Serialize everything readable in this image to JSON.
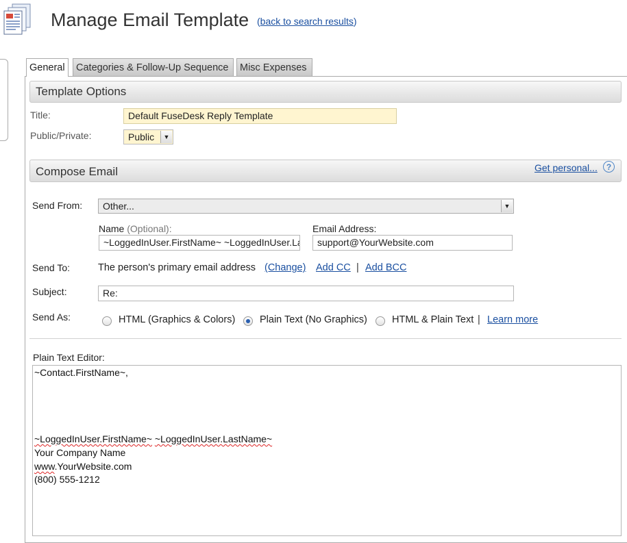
{
  "header": {
    "title": "Manage Email Template",
    "back_open": "(",
    "back_link": "back to search results",
    "back_close": ")"
  },
  "tabs": [
    {
      "label": "General",
      "active": true
    },
    {
      "label": "Categories & Follow-Up Sequence",
      "active": false
    },
    {
      "label": "Misc Expenses",
      "active": false
    }
  ],
  "template_options": {
    "heading": "Template Options",
    "title_label": "Title:",
    "title_value": "Default FuseDesk Reply Template",
    "public_label": "Public/Private:",
    "public_value": "Public"
  },
  "compose": {
    "heading": "Compose Email",
    "get_personal": "Get personal...",
    "send_from_label": "Send From:",
    "send_from_value": "Other...",
    "name_label": "Name",
    "name_optional": "(Optional):",
    "name_value": "~LoggedInUser.FirstName~ ~LoggedInUser.LastName~",
    "email_label": "Email Address:",
    "email_value": "support@YourWebsite.com",
    "send_to_label": "Send To:",
    "send_to_text": "The person's primary email address",
    "change_link": "(Change)",
    "add_cc": "Add CC",
    "sep": "|",
    "add_bcc": "Add BCC",
    "subject_label": "Subject:",
    "subject_value": "Re:",
    "send_as_label": "Send As:",
    "send_as_options": [
      {
        "label": "HTML (Graphics & Colors)",
        "selected": false
      },
      {
        "label": "Plain Text (No Graphics)",
        "selected": true
      },
      {
        "label": "HTML & Plain Text",
        "selected": false
      }
    ],
    "send_as_sep": "|",
    "learn_more": "Learn more"
  },
  "editor": {
    "label": "Plain Text Editor:",
    "line1": "~Contact.FirstName~,",
    "sig1_a": "~LoggedInUser.FirstName~",
    "sig1_b": "~LoggedInUser.LastName~",
    "sig2": "Your Company Name",
    "sig3_a": "www",
    "sig3_b": ".YourWebsite.com",
    "sig4": "(800) 555-1212"
  },
  "colors": {
    "link": "#1a4fa0",
    "title_input_bg": "#fff5d0",
    "section_header": "#dcdcdc"
  }
}
